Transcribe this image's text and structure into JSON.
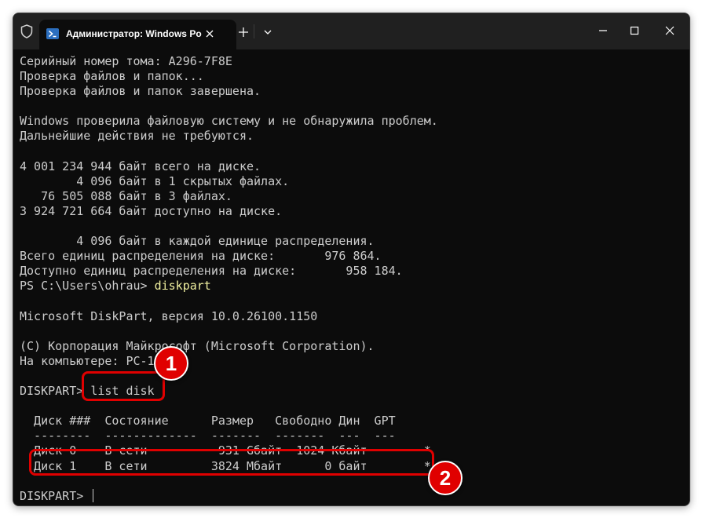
{
  "tab": {
    "title": "Администратор: Windows Po"
  },
  "terminal": {
    "lines": [
      "Серийный номер тома: A296-7F8E",
      "Проверка файлов и папок...",
      "Проверка файлов и папок завершена.",
      "",
      "Windows проверила файловую систему и не обнаружила проблем.",
      "Дальнейшие действия не требуются.",
      "",
      "4 001 234 944 байт всего на диске.",
      "        4 096 байт в 1 скрытых файлах.",
      "   76 505 088 байт в 3 файлах.",
      "3 924 721 664 байт доступно на диске.",
      "",
      "        4 096 байт в каждой единице распределения.",
      "Всего единиц распределения на диске:       976 864.",
      "Доступно единиц распределения на диске:       958 184."
    ],
    "prompt1": "PS C:\\Users\\ohrau> ",
    "cmd1": "diskpart",
    "lines2": [
      "",
      "Microsoft DiskPart, версия 10.0.26100.1150",
      "",
      "(C) Корпорация Майкрософт (Microsoft Corporation).",
      "На компьютере: PC-1",
      ""
    ],
    "prompt2": "DISKPART> ",
    "cmd2": "list disk",
    "table": [
      "",
      "  Диск ###  Состояние      Размер   Свободно Дин  GPT",
      "  --------  -------------  -------  -------  ---  ---",
      "  Диск 0    В сети          931 Gбайт  1024 Kбайт        *",
      "  Диск 1    В сети         3824 Mбайт      0 байт        *",
      ""
    ],
    "prompt3": "DISKPART> "
  },
  "annotations": {
    "badge1": "1",
    "badge2": "2"
  },
  "colors": {
    "highlight": "#e00000",
    "command": "#f1f1a0",
    "text": "#cccccc",
    "background": "#0c0c0c"
  }
}
